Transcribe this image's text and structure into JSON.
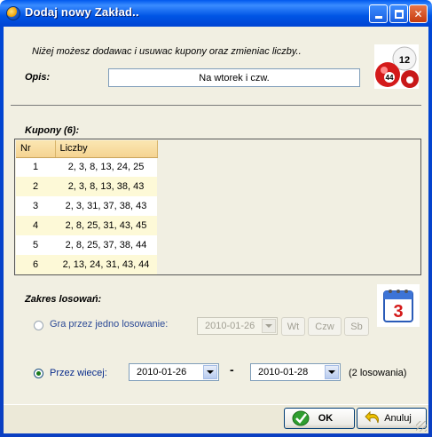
{
  "window": {
    "title": "Dodaj nowy Zakład..",
    "icon": "app-globe-icon",
    "controls": [
      "minimize-icon",
      "maximize-icon",
      "close-icon"
    ]
  },
  "header": {
    "info_text": "Niżej możesz dodawac i usuwac kupony oraz zmieniac liczby..",
    "opis_label": "Opis:",
    "opis_value": "Na wtorek i czw."
  },
  "kupony": {
    "label": "Kupony (6):",
    "columns": [
      "Nr",
      "Liczby"
    ],
    "rows": [
      {
        "nr": "1",
        "liczby": "2, 3, 8, 13, 24, 25"
      },
      {
        "nr": "2",
        "liczby": "2, 3, 8, 13, 38, 43"
      },
      {
        "nr": "3",
        "liczby": "2, 3, 31, 37, 38, 43"
      },
      {
        "nr": "4",
        "liczby": "2, 8, 25, 31, 43, 45"
      },
      {
        "nr": "5",
        "liczby": "2, 8, 25, 37, 38, 44"
      },
      {
        "nr": "6",
        "liczby": "2, 13, 24, 31, 43, 44"
      }
    ]
  },
  "zakres": {
    "label": "Zakres losowań:",
    "single": {
      "label": "Gra przez jedno losowanie:",
      "date": "2010-01-26",
      "days": [
        "Wt",
        "Czw",
        "Sb"
      ],
      "checked": false
    },
    "multi": {
      "label": "Przez wiecej:",
      "from": "2010-01-26",
      "separator": "-",
      "to": "2010-01-28",
      "count_text": "(2 losowania)",
      "checked": true
    }
  },
  "buttons": {
    "ok": "OK",
    "cancel": "Anuluj"
  },
  "colors": {
    "titlebar": "#0055e5",
    "dialog_bg": "#f1efe2",
    "grid_header": "#f5d391",
    "grid_alt_row": "#fdf9d7",
    "radio_text": "#0a2d8c"
  }
}
